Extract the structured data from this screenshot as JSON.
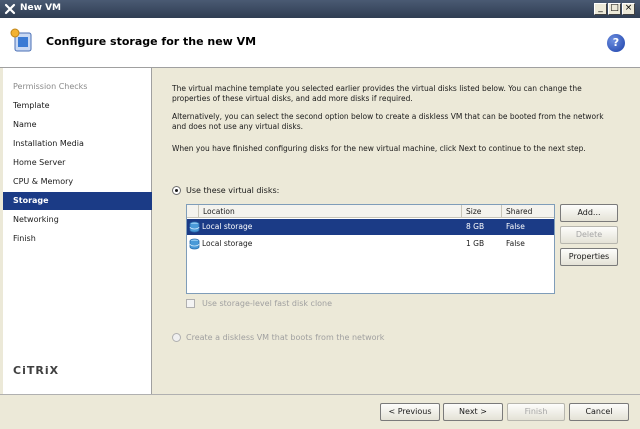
{
  "window": {
    "title": "New VM",
    "minimize": "_",
    "maximize": "□",
    "close": "×"
  },
  "header": {
    "title": "Configure storage for the new VM",
    "help": "?"
  },
  "sidebar": {
    "steps": [
      {
        "label": "Permission Checks",
        "state": "disabled"
      },
      {
        "label": "Template",
        "state": "normal"
      },
      {
        "label": "Name",
        "state": "normal"
      },
      {
        "label": "Installation Media",
        "state": "normal"
      },
      {
        "label": "Home Server",
        "state": "normal"
      },
      {
        "label": "CPU & Memory",
        "state": "normal"
      },
      {
        "label": "Storage",
        "state": "active"
      },
      {
        "label": "Networking",
        "state": "normal"
      },
      {
        "label": "Finish",
        "state": "normal"
      }
    ],
    "logo": "CiTRiX"
  },
  "main": {
    "paragraphs": [
      "The virtual machine template you selected earlier provides the virtual disks listed below. You can change the properties of these virtual disks, and add more disks if required.",
      "Alternatively, you can select the second option below to create a diskless VM that can be booted from the network and does not use any virtual disks.",
      "When you have finished configuring disks for the new virtual machine, click Next to continue to the next step."
    ],
    "option_use_disks": "Use these virtual disks:",
    "table": {
      "columns": [
        "Location",
        "Size",
        "Shared"
      ],
      "rows": [
        {
          "location": "Local storage",
          "size": "8 GB",
          "shared": "False",
          "selected": true
        },
        {
          "location": "Local storage",
          "size": "1 GB",
          "shared": "False",
          "selected": false
        }
      ]
    },
    "buttons": {
      "add": "Add...",
      "delete": "Delete",
      "properties": "Properties"
    },
    "fast_clone": "Use storage-level fast disk clone",
    "option_diskless": "Create a diskless VM that boots from the network"
  },
  "footer": {
    "previous": "< Previous",
    "next": "Next >",
    "finish": "Finish",
    "cancel": "Cancel"
  },
  "colors": {
    "title_bar": "#3a4a62",
    "selection": "#1b3b86",
    "background": "#ece9d8"
  }
}
